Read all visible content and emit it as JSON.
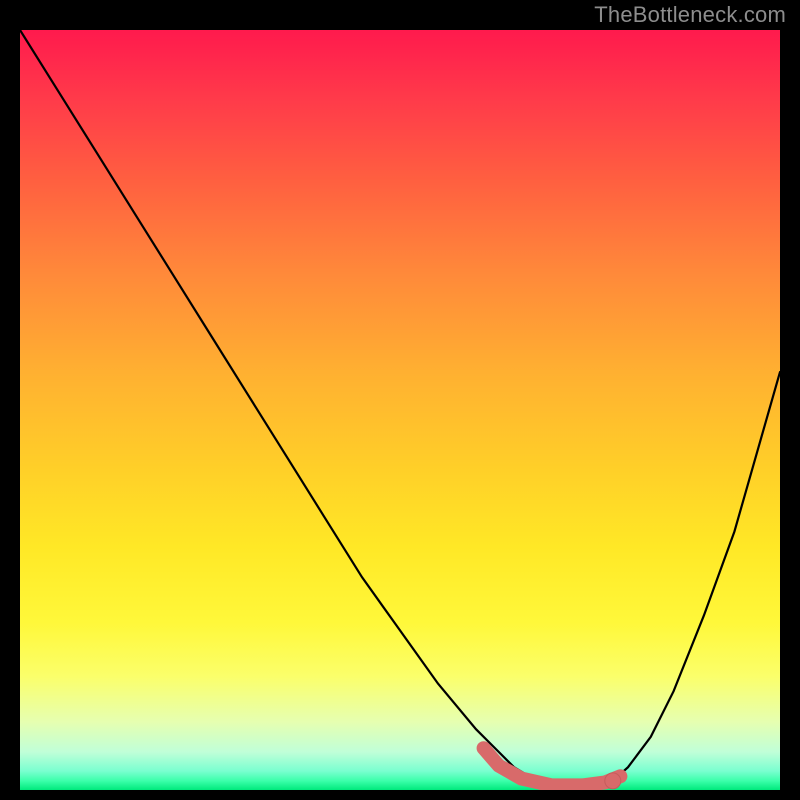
{
  "watermark": "TheBottleneck.com",
  "colors": {
    "background": "#000000",
    "curve": "#000000",
    "marker": "#d86a6a",
    "markerStroke": "#c45c5c"
  },
  "chart_data": {
    "type": "line",
    "title": "",
    "xlabel": "",
    "ylabel": "",
    "xlim": [
      0,
      100
    ],
    "ylim": [
      0,
      100
    ],
    "series": [
      {
        "name": "bottleneck-curve",
        "x": [
          0,
          5,
          10,
          15,
          20,
          25,
          30,
          35,
          40,
          45,
          50,
          55,
          60,
          62,
          65,
          68,
          72,
          75,
          78,
          80,
          83,
          86,
          90,
          94,
          100
        ],
        "y": [
          100,
          92,
          84,
          76,
          68,
          60,
          52,
          44,
          36,
          28,
          21,
          14,
          8,
          6,
          3,
          1.2,
          0.5,
          0.5,
          1.2,
          3,
          7,
          13,
          23,
          34,
          55
        ]
      }
    ],
    "markers": [
      {
        "name": "selected-range-start",
        "x": 62,
        "y": 6
      },
      {
        "name": "selected-range-end",
        "x": 78,
        "y": 1.2
      }
    ],
    "selected_segment": {
      "x": [
        61,
        63,
        66,
        70,
        74,
        77,
        79
      ],
      "y": [
        5.5,
        3.2,
        1.5,
        0.6,
        0.6,
        1.0,
        1.8
      ]
    }
  }
}
